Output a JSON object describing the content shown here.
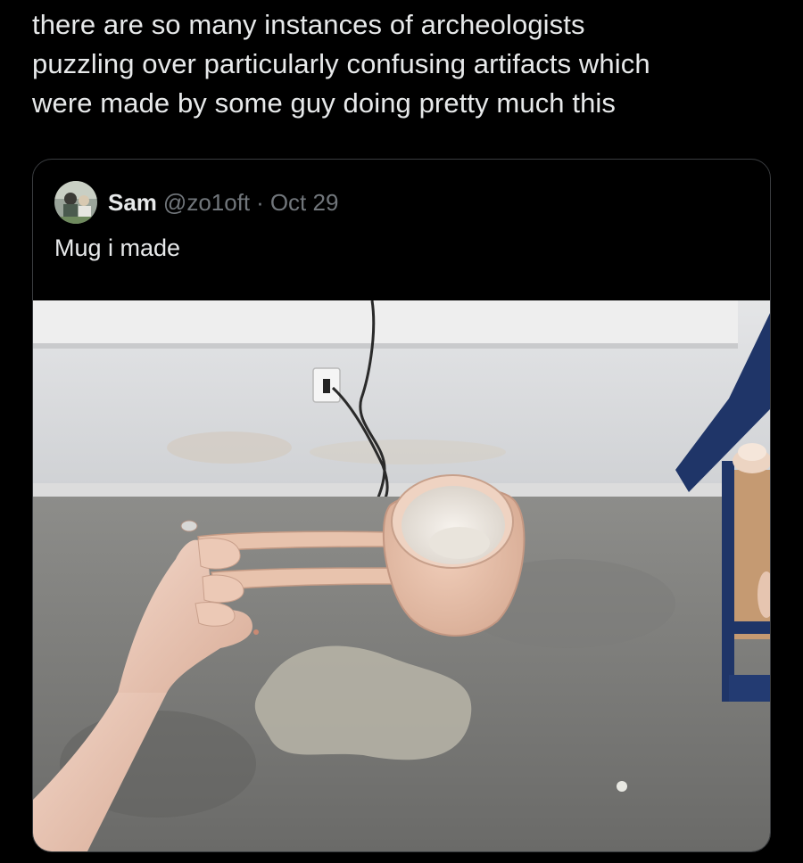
{
  "post": {
    "lines": [
      "there are so many instances of archeologists",
      "puzzling over particularly confusing artifacts which",
      "were made by some guy doing pretty much this"
    ]
  },
  "quote": {
    "author_name": "Sam",
    "handle": "@zo1oft",
    "separator": "·",
    "date": "Oct 29",
    "text": "Mug i made"
  },
  "colors": {
    "background": "#000000",
    "text_primary": "#e7e9ea",
    "text_secondary": "#71767b",
    "card_border": "#3a3d40"
  },
  "icons": {
    "avatar": "user-avatar-photo"
  }
}
